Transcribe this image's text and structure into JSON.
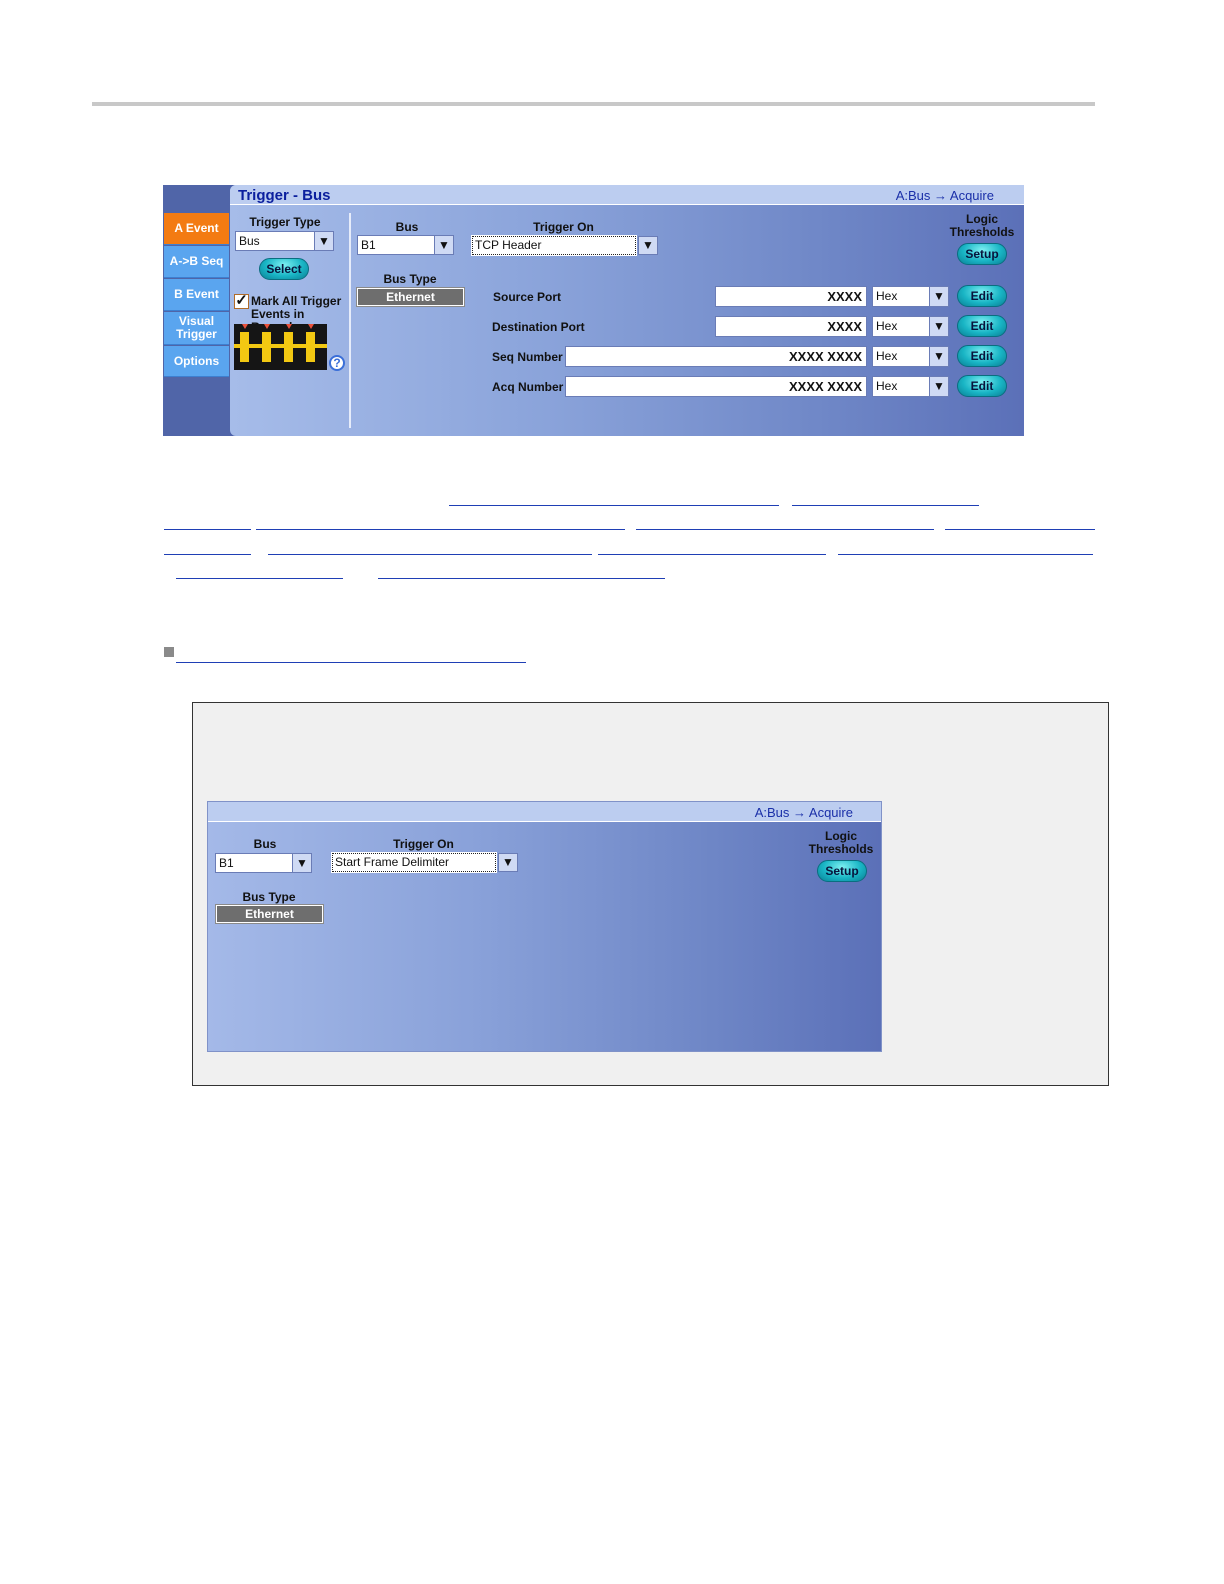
{
  "panel": {
    "tabs": [
      "A Event",
      "A->B Seq",
      "B Event",
      "Visual Trigger",
      "Options"
    ],
    "title": "Trigger - Bus",
    "crumb": "A:Bus → Acquire",
    "trigger_type_label": "Trigger Type",
    "trigger_type_value": "Bus",
    "select_label": "Select",
    "mark_all_label": "Mark All Trigger Events in Record",
    "mark_all_checked": "✓",
    "help_glyph": "?",
    "bus_label": "Bus",
    "bus_value": "B1",
    "trigger_on_label": "Trigger On",
    "trigger_on_value": "TCP Header",
    "bus_type_label": "Bus Type",
    "bus_type_value": "Ethernet",
    "logic_label": "Logic Thresholds",
    "setup_label": "Setup",
    "dropdown_arrow": "▼",
    "rows": [
      {
        "label": "Source Port",
        "value": "XXXX",
        "format": "Hex",
        "edit": "Edit"
      },
      {
        "label": "Destination Port",
        "value": "XXXX",
        "format": "Hex",
        "edit": "Edit"
      },
      {
        "label": "Seq Number",
        "value": "XXXX XXXX",
        "format": "Hex",
        "edit": "Edit"
      },
      {
        "label": "Acq Number",
        "value": "XXXX XXXX",
        "format": "Hex",
        "edit": "Edit"
      }
    ]
  },
  "note_panel": {
    "crumb": "A:Bus → Acquire",
    "bus_label": "Bus",
    "bus_value": "B1",
    "trigger_on_label": "Trigger On",
    "trigger_on_value": "Start Frame Delimiter",
    "bus_type_label": "Bus Type",
    "bus_type_value": "Ethernet",
    "logic_label": "Logic Thresholds",
    "setup_label": "Setup",
    "dropdown_arrow": "▼"
  },
  "colors": {
    "tab_active": "#f37b12",
    "tab": "#5aa5ef",
    "title_text": "#0b1f9e",
    "link_underline": "#1f3fb5"
  }
}
